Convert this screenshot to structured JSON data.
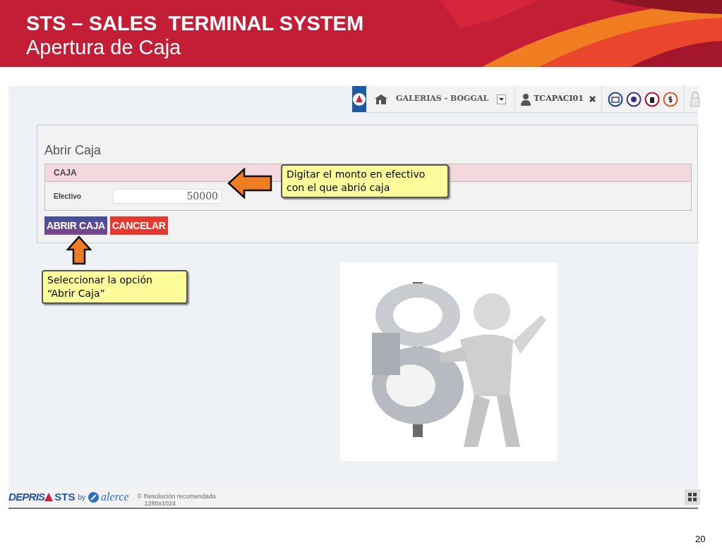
{
  "slide": {
    "title": "STS – SALES  TERMINAL SYSTEM",
    "subtitle": "Apertura de Caja",
    "page_number": "20"
  },
  "toolbar": {
    "branch": "GALERIAS - BOGGAL",
    "user": "TCAPACI01"
  },
  "form": {
    "title": "Abrir Caja",
    "section": "CAJA",
    "fields": [
      {
        "label": "Efectivo",
        "value": "50000"
      }
    ],
    "buttons": [
      {
        "label": "ABRIR CAJA",
        "kind": "primary"
      },
      {
        "label": "CANCELAR",
        "kind": "danger"
      }
    ]
  },
  "callouts": [
    {
      "text": "Digitar el monto en efectivo con el que abrió caja",
      "kind": "left"
    },
    {
      "text": "Seleccionar la opción “Abrir Caja”",
      "kind": "up"
    }
  ],
  "footer": {
    "brand": "DEPRIS",
    "product": "STS",
    "by": "by",
    "partner": "alerce",
    "note": "© Resolución recomendada",
    "resolution": "1280x1024"
  }
}
